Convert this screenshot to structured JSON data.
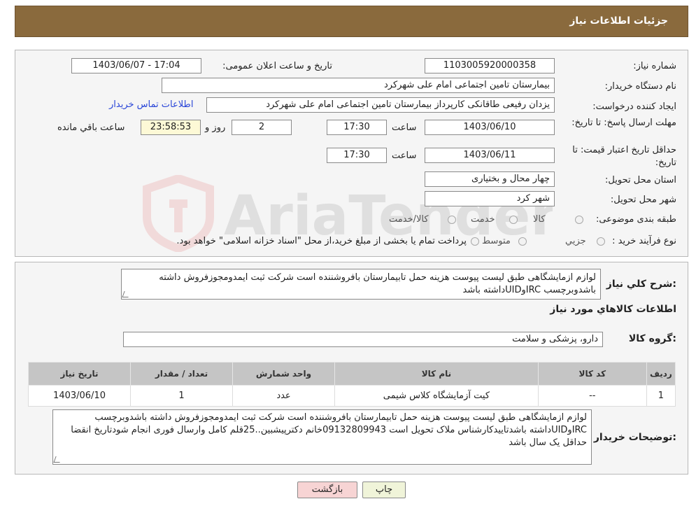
{
  "header": {
    "title": "جزئیات اطلاعات نیاز"
  },
  "info": {
    "need_number_label": "شماره نیاز:",
    "need_number": "1103005920000358",
    "announce_label": "تاریخ و ساعت اعلان عمومی:",
    "announce_value": "1403/06/07 - 17:04",
    "buyer_org_label": "نام دستگاه خریدار:",
    "buyer_org": "بیمارستان تامین اجتماعی امام علی شهرکرد",
    "creator_label": "ایجاد کننده درخواست:",
    "creator": "یزدان رفیعی طاقانکی کارپرداز بیمارستان تامین اجتماعی امام علی شهرکرد",
    "contact_link": "اطلاعات تماس خریدار",
    "deadline_label": "مهلت ارسال پاسخ: تا تاریخ:",
    "deadline_date": "1403/06/10",
    "time_label": "ساعت",
    "deadline_time": "17:30",
    "days_value": "2",
    "days_label": "روز و",
    "remaining_value": "23:58:53",
    "remaining_label": "ساعت باقي مانده",
    "validity_label": "حداقل تاریخ اعتبار قیمت: تا تاریخ:",
    "validity_date": "1403/06/11",
    "validity_time": "17:30",
    "province_label": "استان محل تحویل:",
    "province": "چهار محال و بختیاری",
    "city_label": "شهر محل تحویل:",
    "city": "شهر کرد",
    "category_label": "طبقه بندی موضوعی:",
    "category_options": [
      "کالا",
      "خدمت",
      "کالا/خدمت"
    ],
    "process_label": "نوع فرآیند خرید :",
    "process_options": [
      "جزیي",
      "متوسط"
    ],
    "process_note": "پرداخت تمام یا بخشی از مبلغ خرید،از محل \"اسناد خزانه اسلامی\" خواهد بود."
  },
  "description": {
    "label": "شرح كلي نياز:",
    "text": "لوازم ازمایشگاهی طبق لیست پیوست هزینه حمل تابیمارستان بافروشننده است شرکت ثبت ایمدومجوزفروش داشته باشدوبرچسب IRCوUIDداشته باشد"
  },
  "goods": {
    "section_title": "اطلاعات كالاهاي مورد نياز",
    "group_label": "گروه كالا:",
    "group_value": "دارو، پزشکی و سلامت",
    "columns": [
      "رديف",
      "کد کالا",
      "نام کالا",
      "واحد شمارش",
      "تعداد / مقدار",
      "تاریخ نیاز"
    ],
    "rows": [
      [
        "1",
        "--",
        "کیت آزمایشگاه کلاس شیمی",
        "عدد",
        "1",
        "1403/06/10"
      ]
    ]
  },
  "buyer_notes": {
    "label": "توضیحات خریدار:",
    "text": "لوازم ازمایشگاهی طبق لیست پیوست هزینه حمل تابیمارستان بافروشننده است شرکت ثبت ایمدومجوزفروش داشته باشدوبرچسب IRCوUIDداشته باشدتاییدکارشناس ملاک تحویل است 09132809943خانم دکترپیشبین..25قلم کامل وارسال فوری انجام شودتاریخ انقضا حداقل یک سال باشد"
  },
  "buttons": {
    "print": "چاپ",
    "back": "بازگشت"
  },
  "watermark": {
    "text": "AriaTender.neT"
  },
  "colors": {
    "header": "#8a6a3d",
    "link": "#2a46d8",
    "back_button": "#f7d4d4",
    "print_button": "#f0f4d9"
  }
}
